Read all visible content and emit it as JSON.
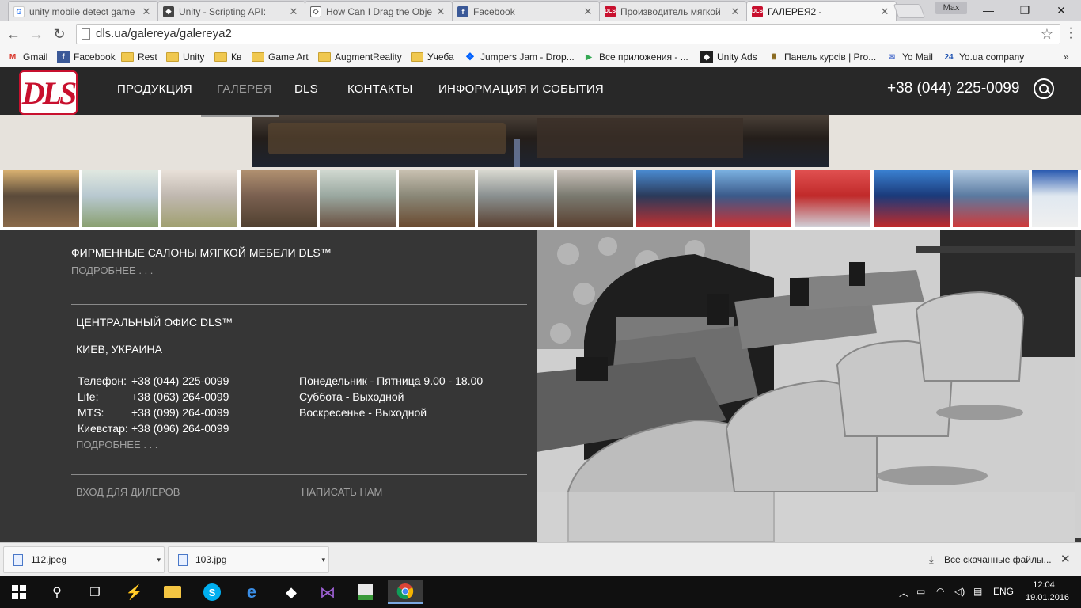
{
  "browser": {
    "tabs": [
      {
        "title": "unity mobile detect game",
        "icon": "google-icon",
        "active": false
      },
      {
        "title": "Unity - Scripting API:",
        "icon": "unity-icon",
        "active": false
      },
      {
        "title": "How Can I Drag the Obje",
        "icon": "unity-answers-icon",
        "active": false
      },
      {
        "title": "Facebook",
        "icon": "facebook-icon",
        "active": false
      },
      {
        "title": "Производитель мягкой",
        "icon": "dls-icon",
        "active": false
      },
      {
        "title": "ГАЛЕРЕЯ2 -",
        "icon": "dls-icon",
        "active": true
      }
    ],
    "user_badge": "Max",
    "window_controls": {
      "minimize": "—",
      "maximize": "❐",
      "close": "✕"
    },
    "address": "dls.ua/galereya/galereya2",
    "bookmarks": [
      {
        "label": "Gmail",
        "icon": "gmail-icon"
      },
      {
        "label": "Facebook",
        "icon": "facebook-icon"
      },
      {
        "label": "Rest",
        "icon": "folder-icon"
      },
      {
        "label": "Unity",
        "icon": "folder-icon"
      },
      {
        "label": "Кв",
        "icon": "folder-icon"
      },
      {
        "label": "Game Art",
        "icon": "folder-icon"
      },
      {
        "label": "AugmentReality",
        "icon": "folder-icon"
      },
      {
        "label": "Учеба",
        "icon": "folder-icon"
      },
      {
        "label": "Jumpers Jam - Drop...",
        "icon": "dropbox-icon"
      },
      {
        "label": "Все приложения - ...",
        "icon": "play-store-icon"
      },
      {
        "label": "Unity Ads",
        "icon": "unity-icon"
      },
      {
        "label": "Панель курсів | Pro...",
        "icon": "course-icon"
      },
      {
        "label": "Yo Mail",
        "icon": "mail-icon"
      },
      {
        "label": "Yo.ua company",
        "icon": "yo24-icon"
      }
    ],
    "bookmarks_more": "»"
  },
  "site": {
    "logo_text": "DLS",
    "nav": [
      {
        "label": "ПРОДУКЦИЯ",
        "active": false
      },
      {
        "label": "ГАЛЕРЕЯ",
        "active": true
      },
      {
        "label": "DLS",
        "active": false
      },
      {
        "label": "КОНТАКТЫ",
        "active": false
      },
      {
        "label": "ИНФОРМАЦИЯ И СОБЫТИЯ",
        "active": false
      }
    ],
    "phone": "+38 (044) 225-0099",
    "thumbnails": [
      {
        "palette": [
          "#5a4a3a",
          "#d8b070",
          "#8a6a4a"
        ]
      },
      {
        "palette": [
          "#b8c8d0",
          "#e0e8e0",
          "#8aa070"
        ]
      },
      {
        "palette": [
          "#c0b8b0",
          "#e8e0d8",
          "#a0a070"
        ]
      },
      {
        "palette": [
          "#7a6050",
          "#b09070",
          "#504030"
        ]
      },
      {
        "palette": [
          "#9aa8a0",
          "#d0d8d0",
          "#6a5040"
        ]
      },
      {
        "palette": [
          "#8a8878",
          "#c8c0b0",
          "#6a4a30"
        ]
      },
      {
        "palette": [
          "#8a9090",
          "#d8d8d0",
          "#5a4030"
        ]
      },
      {
        "palette": [
          "#7a7a70",
          "#c8c0b8",
          "#5a4030"
        ]
      },
      {
        "palette": [
          "#2a3a5a",
          "#4a8ad0",
          "#c03030"
        ]
      },
      {
        "palette": [
          "#3a5a8a",
          "#7ab0e0",
          "#d03030"
        ]
      },
      {
        "palette": [
          "#c02a2a",
          "#e05050",
          "#d0d0d8"
        ]
      },
      {
        "palette": [
          "#1a3a7a",
          "#3a80d0",
          "#c02a2a"
        ]
      },
      {
        "palette": [
          "#5a7aa0",
          "#b0c8e0",
          "#d03a3a"
        ]
      },
      {
        "palette": [
          "#e0e8f0",
          "#2a5ab0",
          "#f0f0f0"
        ]
      }
    ],
    "footer": {
      "salons_title": "ФИРМЕННЫЕ САЛОНЫ МЯГКОЙ МЕБЕЛИ DLS™",
      "salons_more": "ПОДРОБНЕЕ . . .",
      "office_title": "ЦЕНТРАЛЬНЫЙ ОФИС DLS™",
      "city": "КИЕВ, УКРАИНА",
      "phones": [
        {
          "label": "Телефон:",
          "number": "+38 (044) 225-0099"
        },
        {
          "label": "Life:",
          "number": "+38 (063) 264-0099"
        },
        {
          "label": "MTS:",
          "number": "+38 (099) 264-0099"
        },
        {
          "label": "Киевстар:",
          "number": "+38 (096) 264-0099"
        }
      ],
      "hours": [
        "Понедельник - Пятница 9.00 - 18.00",
        "Суббота - Выходной",
        "Воскресенье - Выходной"
      ],
      "office_more": "ПОДРОБНЕЕ . . .",
      "dealer_login": "ВХОД ДЛЯ ДИЛЕРОВ",
      "write_us": "НАПИСАТЬ НАМ"
    }
  },
  "downloads": {
    "items": [
      {
        "name": "112.jpeg"
      },
      {
        "name": "103.jpg"
      }
    ],
    "all_label": "Все скачанные файлы...",
    "close": "✕"
  },
  "taskbar": {
    "language": "ENG",
    "time": "12:04",
    "date": "19.01.2016"
  }
}
